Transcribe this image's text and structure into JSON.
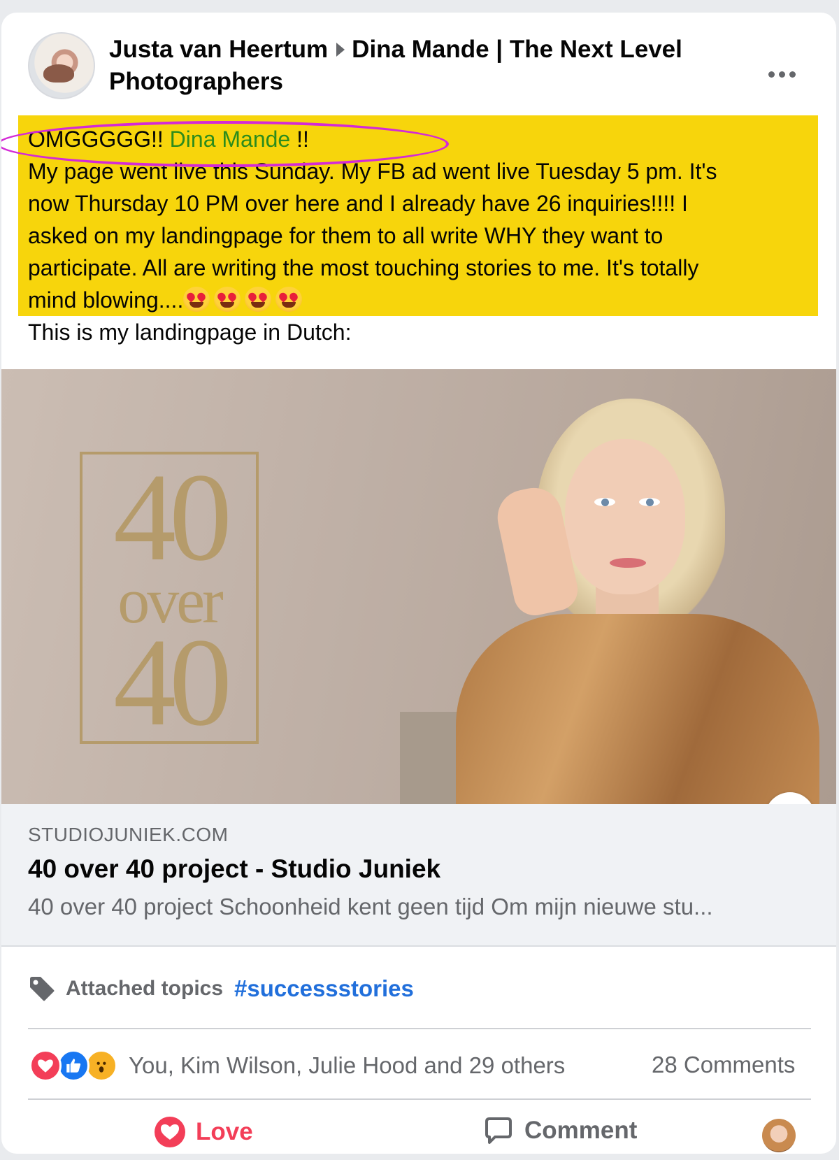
{
  "post": {
    "author": "Justa van Heertum",
    "group": "Dina Mande | The Next Level Photographers",
    "text": {
      "line1_prefix": "OMGGGGG!! ",
      "line1_mention": "Dina Mande",
      "line1_suffix": " !!",
      "line2": "My page went live this Sunday. My FB ad went live Tuesday 5 pm. It's",
      "line3": "now Thursday 10 PM over here and I already have 26 inquiries!!!! I",
      "line4": "asked on my landingpage for them to all write WHY they want to",
      "line5": "participate. All are writing the most touching stories to me. It's totally",
      "line6": "mind blowing....",
      "line7": "This is my landingpage in Dutch:"
    }
  },
  "image": {
    "logo_top": "40",
    "logo_mid": "over",
    "logo_bottom": "40",
    "info_icon": "info-icon"
  },
  "link_preview": {
    "domain": "STUDIOJUNIEK.COM",
    "title": "40 over 40 project - Studio Juniek",
    "description": "40 over 40 project Schoonheid kent geen tijd Om mijn nieuwe stu..."
  },
  "topics": {
    "label": "Attached topics",
    "hashtag": "#successstories"
  },
  "reactions": {
    "names": "You, Kim Wilson, Julie Hood and 29 others",
    "comments": "28 Comments"
  },
  "actions": {
    "love": "Love",
    "comment": "Comment"
  },
  "colors": {
    "highlight": "#f7d50c",
    "mention": "#2c8c1c",
    "hashtag": "#216fdb",
    "love": "#f33e58",
    "annotation_circle": "#d42ad6"
  }
}
